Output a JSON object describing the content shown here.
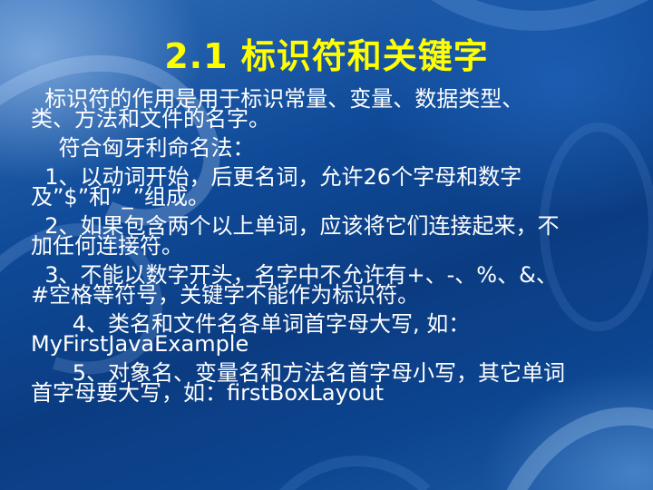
{
  "slide": {
    "title": "2.1 标识符和关键字",
    "paragraphs": [
      [
        "  标识符的作用是用于标识常量、变量、数据类型、",
        "类、方法和文件的名字。"
      ],
      [
        "    符合匈牙利命名法："
      ],
      [
        "  1、以动词开始，后更名词，允许26个字母和数字",
        "及”$”和”_”组成。"
      ],
      [
        "  2、如果包含两个以上单词，应该将它们连接起来，不",
        "加任何连接符。"
      ],
      [
        "  3、不能以数字开头，名字中不允许有+、-、%、&、",
        "#空格等符号，关键字不能作为标识符。"
      ],
      [
        "      4、类名和文件名各单词首字母大写, 如：",
        "MyFirstJavaExample"
      ],
      [
        "      5、对象名、变量名和方法名首字母小写，其它单词",
        "首字母要大写，如：firstBoxLayout"
      ]
    ]
  },
  "colors": {
    "title": "#ffff00",
    "text": "#ffffff",
    "background": "#0b3c82"
  }
}
